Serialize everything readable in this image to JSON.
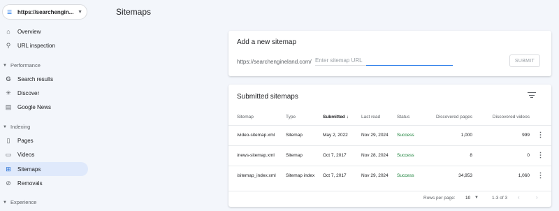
{
  "property": {
    "label": "https://searchengin...",
    "icon": "property-icon"
  },
  "sidebar": {
    "items_top": [
      {
        "label": "Overview",
        "icon": "home-icon"
      },
      {
        "label": "URL inspection",
        "icon": "search-icon"
      }
    ],
    "performance_label": "Performance",
    "performance_items": [
      {
        "label": "Search results",
        "icon": "google-icon"
      },
      {
        "label": "Discover",
        "icon": "asterisk-icon"
      },
      {
        "label": "Google News",
        "icon": "news-icon"
      }
    ],
    "indexing_label": "Indexing",
    "indexing_items": [
      {
        "label": "Pages",
        "icon": "pages-icon"
      },
      {
        "label": "Videos",
        "icon": "video-icon"
      },
      {
        "label": "Sitemaps",
        "icon": "sitemap-icon",
        "active": true
      },
      {
        "label": "Removals",
        "icon": "removal-icon"
      }
    ],
    "experience_label": "Experience"
  },
  "page": {
    "title": "Sitemaps"
  },
  "add_sitemap": {
    "title": "Add a new sitemap",
    "prefix": "https://searchengineland.com/",
    "placeholder": "Enter sitemap URL",
    "value": "",
    "submit_label": "SUBMIT"
  },
  "submitted": {
    "title": "Submitted sitemaps",
    "columns": {
      "sitemap": "Sitemap",
      "type": "Type",
      "submitted": "Submitted",
      "last_read": "Last read",
      "status": "Status",
      "discovered_pages": "Discovered pages",
      "discovered_videos": "Discovered videos"
    },
    "rows": [
      {
        "sitemap": "/video-sitemap.xml",
        "type": "Sitemap",
        "submitted": "May 2, 2022",
        "last_read": "Nov 29, 2024",
        "status": "Success",
        "pages": "1,000",
        "videos": "999"
      },
      {
        "sitemap": "/news-sitemap.xml",
        "type": "Sitemap",
        "submitted": "Oct 7, 2017",
        "last_read": "Nov 28, 2024",
        "status": "Success",
        "pages": "8",
        "videos": "0"
      },
      {
        "sitemap": "/sitemap_index.xml",
        "type": "Sitemap index",
        "submitted": "Oct 7, 2017",
        "last_read": "Nov 29, 2024",
        "status": "Success",
        "pages": "34,953",
        "videos": "1,060"
      }
    ],
    "pager": {
      "rows_label": "Rows per page:",
      "rows_value": "10",
      "range": "1-3 of 3"
    }
  },
  "colors": {
    "accent": "#1a73e8",
    "active_bg": "#dfe9fb",
    "success": "#188038",
    "page_bg": "#f3f6fb"
  }
}
